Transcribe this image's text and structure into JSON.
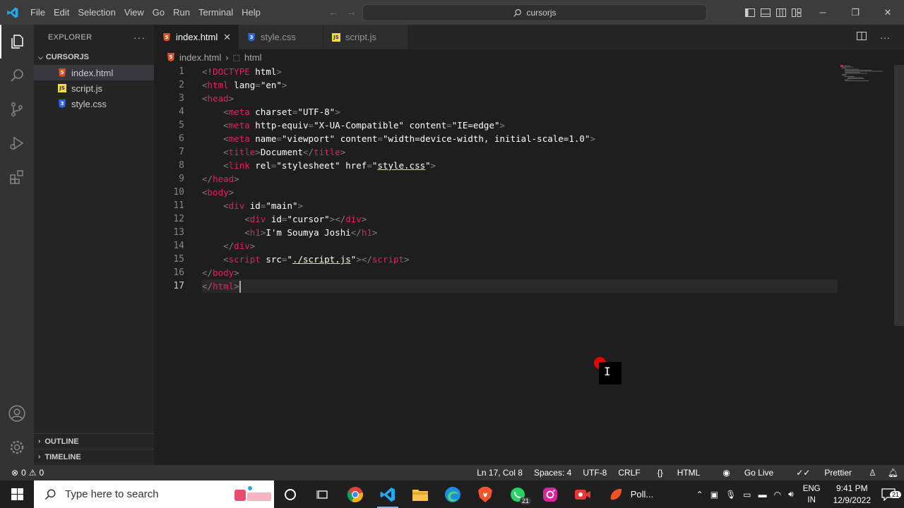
{
  "titlebar": {
    "menu": [
      "File",
      "Edit",
      "Selection",
      "View",
      "Go",
      "Run",
      "Terminal",
      "Help"
    ],
    "search_label": "cursorjs"
  },
  "explorer": {
    "header": "EXPLORER",
    "folder": "CURSORJS",
    "files": [
      {
        "name": "index.html",
        "type": "html",
        "selected": true
      },
      {
        "name": "script.js",
        "type": "js",
        "selected": false
      },
      {
        "name": "style.css",
        "type": "css",
        "selected": false
      }
    ],
    "outline_label": "OUTLINE",
    "timeline_label": "TIMELINE"
  },
  "tabs": [
    {
      "label": "index.html",
      "type": "html",
      "active": true
    },
    {
      "label": "style.css",
      "type": "css",
      "active": false
    },
    {
      "label": "script.js",
      "type": "js",
      "active": false
    }
  ],
  "breadcrumb": {
    "file": "index.html",
    "symbol": "html"
  },
  "editor": {
    "line_numbers": [
      "1",
      "2",
      "3",
      "4",
      "5",
      "6",
      "7",
      "8",
      "9",
      "10",
      "11",
      "12",
      "13",
      "14",
      "15",
      "16",
      "17"
    ],
    "current_line": 17
  },
  "statusbar": {
    "errors": "0",
    "warnings": "0",
    "position": "Ln 17, Col 8",
    "spaces": "Spaces: 4",
    "encoding": "UTF-8",
    "eol": "CRLF",
    "language": "HTML",
    "golive": "Go Live",
    "prettier": "Prettier"
  },
  "taskbar": {
    "search_placeholder": "Type here to search",
    "whatsapp_badge": "21",
    "app_label": "Poll...",
    "lang_top": "ENG",
    "lang_bottom": "IN",
    "time": "9:41 PM",
    "date": "12/9/2022",
    "notification_count": "21"
  },
  "colors": {
    "accent": "#007acc",
    "tag": "#e91e63",
    "editor_bg": "#1e1e1e",
    "sidebar_bg": "#252526",
    "activity_bg": "#333333"
  }
}
